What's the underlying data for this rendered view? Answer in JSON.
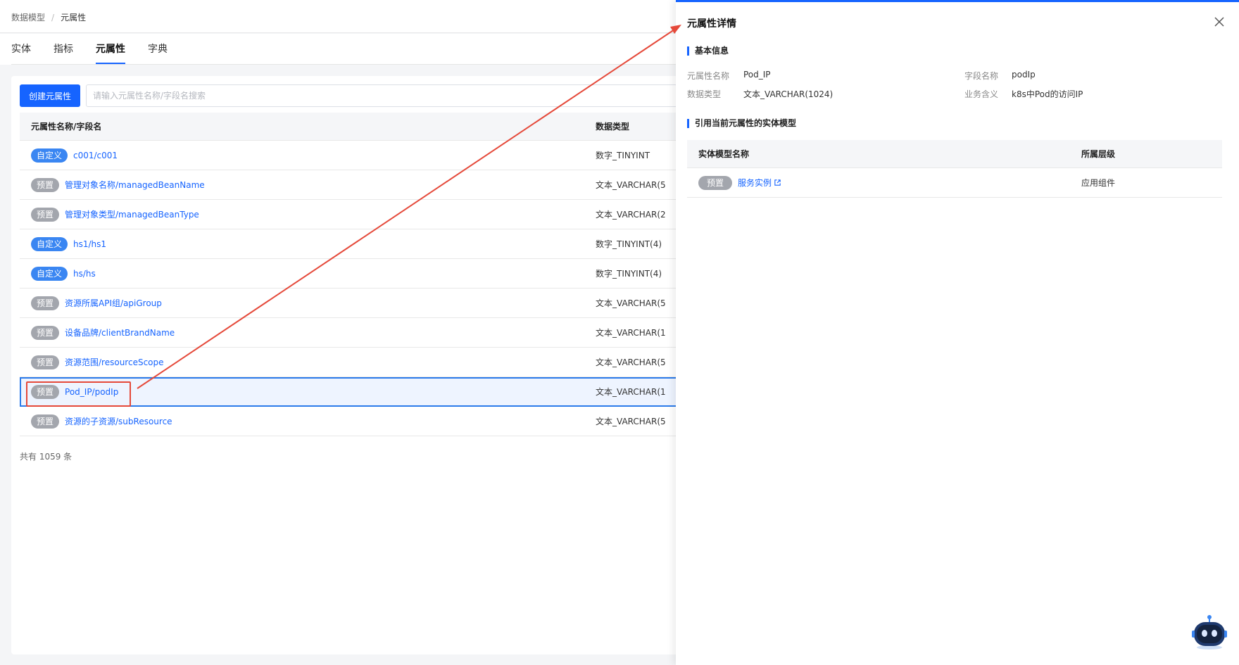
{
  "breadcrumb": {
    "parent": "数据模型",
    "separator": "/",
    "current": "元属性"
  },
  "tabs": [
    {
      "label": "实体",
      "active": false
    },
    {
      "label": "指标",
      "active": false
    },
    {
      "label": "元属性",
      "active": true
    },
    {
      "label": "字典",
      "active": false
    }
  ],
  "toolbar": {
    "create_label": "创建元属性",
    "search_placeholder": "请输入元属性名称/字段名搜索"
  },
  "table": {
    "headers": {
      "name": "元属性名称/字段名",
      "type": "数据类型"
    },
    "rows": [
      {
        "tag": "自定义",
        "tag_kind": "custom",
        "name": "c001/c001",
        "type": "数字_TINYINT",
        "selected": false
      },
      {
        "tag": "预置",
        "tag_kind": "preset",
        "name": "管理对象名称/managedBeanName",
        "type": "文本_VARCHAR(5",
        "selected": false
      },
      {
        "tag": "预置",
        "tag_kind": "preset",
        "name": "管理对象类型/managedBeanType",
        "type": "文本_VARCHAR(2",
        "selected": false
      },
      {
        "tag": "自定义",
        "tag_kind": "custom",
        "name": "hs1/hs1",
        "type": "数字_TINYINT(4)",
        "selected": false
      },
      {
        "tag": "自定义",
        "tag_kind": "custom",
        "name": "hs/hs",
        "type": "数字_TINYINT(4)",
        "selected": false
      },
      {
        "tag": "预置",
        "tag_kind": "preset",
        "name": "资源所属API组/apiGroup",
        "type": "文本_VARCHAR(5",
        "selected": false
      },
      {
        "tag": "预置",
        "tag_kind": "preset",
        "name": "设备品牌/clientBrandName",
        "type": "文本_VARCHAR(1",
        "selected": false
      },
      {
        "tag": "预置",
        "tag_kind": "preset",
        "name": "资源范围/resourceScope",
        "type": "文本_VARCHAR(5",
        "selected": false
      },
      {
        "tag": "预置",
        "tag_kind": "preset",
        "name": "Pod_IP/podIp",
        "type": "文本_VARCHAR(1",
        "selected": true
      },
      {
        "tag": "预置",
        "tag_kind": "preset",
        "name": "资源的子资源/subResource",
        "type": "文本_VARCHAR(5",
        "selected": false
      }
    ],
    "total": "共有 1059 条"
  },
  "drawer": {
    "title": "元属性详情",
    "basic_section": "基本信息",
    "fields": {
      "name_label": "元属性名称",
      "name_value": "Pod_IP",
      "field_label": "字段名称",
      "field_value": "podIp",
      "dtype_label": "数据类型",
      "dtype_value": "文本_VARCHAR(1024)",
      "meaning_label": "业务含义",
      "meaning_value": "k8s中Pod的访问IP"
    },
    "ref_section": "引用当前元属性的实体模型",
    "ref_headers": {
      "name": "实体模型名称",
      "level": "所属层级"
    },
    "ref_rows": [
      {
        "tag": "预置",
        "name": "服务实例",
        "level": "应用组件"
      }
    ]
  },
  "colors": {
    "accent": "#1664ff",
    "annotation": "#e5493a",
    "tag_custom": "#3a86f2",
    "tag_preset": "#a3a6ad"
  },
  "icons": [
    "close-icon",
    "external-link-icon",
    "robot-assistant-icon"
  ]
}
